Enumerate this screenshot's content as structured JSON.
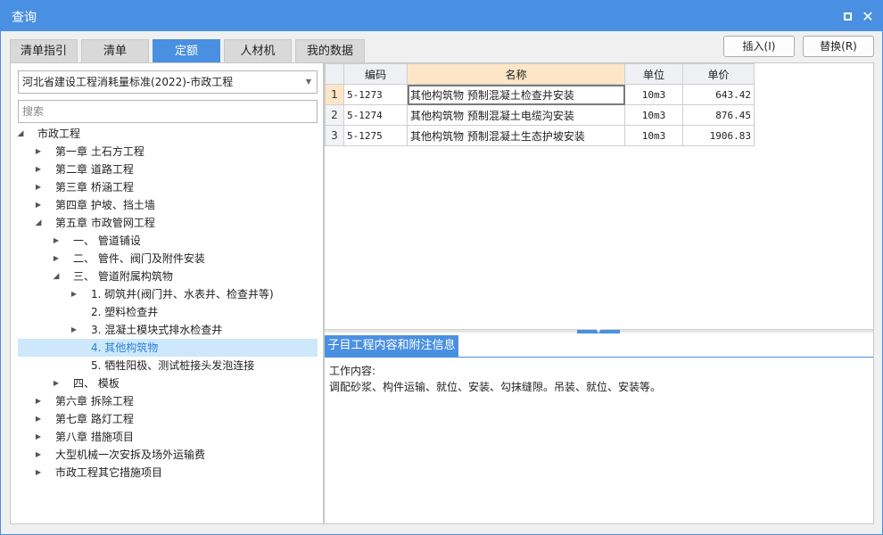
{
  "window": {
    "title": "查询"
  },
  "tabs": [
    {
      "label": "清单指引"
    },
    {
      "label": "清单"
    },
    {
      "label": "定额"
    },
    {
      "label": "人材机"
    },
    {
      "label": "我的数据"
    }
  ],
  "buttons": {
    "insert": "插入(I)",
    "replace": "替换(R)"
  },
  "library": {
    "selected": "河北省建设工程消耗量标准(2022)-市政工程"
  },
  "search": {
    "placeholder": "搜索"
  },
  "tree": [
    {
      "label": "市政工程",
      "state": "expanded"
    },
    {
      "label": "第一章 土石方工程",
      "state": "collapsed"
    },
    {
      "label": "第二章 道路工程",
      "state": "collapsed"
    },
    {
      "label": "第三章 桥涵工程",
      "state": "collapsed"
    },
    {
      "label": "第四章 护坡、挡土墙",
      "state": "collapsed"
    },
    {
      "label": "第五章 市政管网工程",
      "state": "expanded"
    },
    {
      "label": "一、 管道铺设",
      "state": "collapsed"
    },
    {
      "label": "二、 管件、阀门及附件安装",
      "state": "collapsed"
    },
    {
      "label": "三、 管道附属构筑物",
      "state": "expanded"
    },
    {
      "label": "1. 砌筑井(阀门井、水表井、检查井等)",
      "state": "collapsed"
    },
    {
      "label": "2. 塑料检查井",
      "state": "leaf"
    },
    {
      "label": "3. 混凝土模块式排水检查井",
      "state": "collapsed"
    },
    {
      "label": "4. 其他构筑物",
      "state": "leaf",
      "selected": true
    },
    {
      "label": "5. 牺牲阳极、测试桩接头发泡连接",
      "state": "leaf"
    },
    {
      "label": "四、 模板",
      "state": "collapsed"
    },
    {
      "label": "第六章 拆除工程",
      "state": "collapsed"
    },
    {
      "label": "第七章 路灯工程",
      "state": "collapsed"
    },
    {
      "label": "第八章 措施项目",
      "state": "collapsed"
    },
    {
      "label": "大型机械一次安拆及场外运输费",
      "state": "collapsed"
    },
    {
      "label": "市政工程其它措施项目",
      "state": "collapsed"
    }
  ],
  "grid": {
    "columns": [
      "编码",
      "名称",
      "单位",
      "单价"
    ],
    "rows": [
      {
        "no": "1",
        "code": "5-1273",
        "name": "其他构筑物 预制混凝土检查井安装",
        "unit": "10m3",
        "price": "643.42"
      },
      {
        "no": "2",
        "code": "5-1274",
        "name": "其他构筑物 预制混凝土电缆沟安装",
        "unit": "10m3",
        "price": "876.45"
      },
      {
        "no": "3",
        "code": "5-1275",
        "name": "其他构筑物 预制混凝土生态护坡安装",
        "unit": "10m3",
        "price": "1906.83"
      }
    ]
  },
  "detail": {
    "tab_label": "子目工程内容和附注信息",
    "heading": "工作内容:",
    "text": "调配砂浆、构件运输、就位、安装、勾抹缝隙。吊装、就位、安装等。"
  }
}
